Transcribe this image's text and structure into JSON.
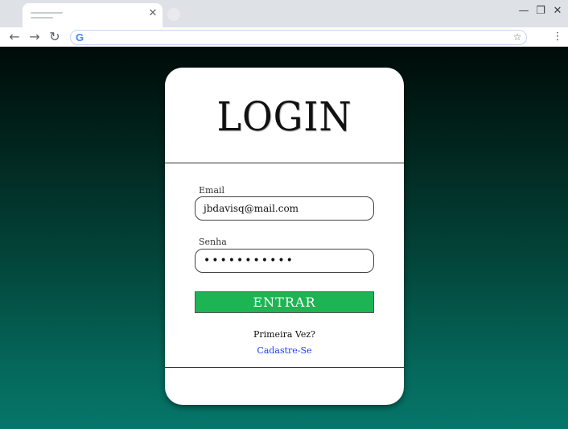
{
  "browser": {
    "tab_close_icon": "✕",
    "window_controls": {
      "minimize": "—",
      "maximize": "❐",
      "close": "✕"
    },
    "nav": {
      "back": "←",
      "forward": "→",
      "reload": "↻"
    },
    "omnibox": {
      "google_icon": "G",
      "star_icon": "☆",
      "value": ""
    },
    "menu_icon": "⋮"
  },
  "login": {
    "title": "LOGIN",
    "email_label": "Email",
    "email_value": "jbdavisq@mail.com",
    "password_label": "Senha",
    "password_masked": "•••••••••••",
    "submit_label": "ENTRAR",
    "first_time_text": "Primeira Vez?",
    "signup_link": "Cadastre-Se"
  },
  "colors": {
    "button_green": "#1db553",
    "link_blue": "#1a3ee8",
    "background_top": "#000b08",
    "background_bottom": "#06766a"
  }
}
